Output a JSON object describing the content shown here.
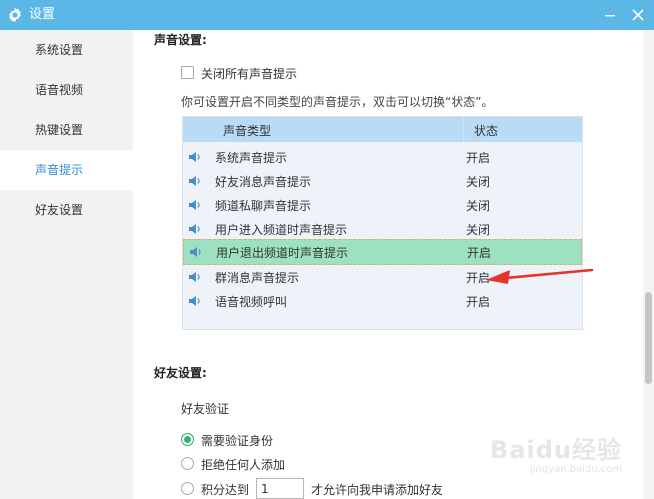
{
  "window": {
    "title": "设置"
  },
  "sidebar": {
    "items": [
      {
        "label": "系统设置"
      },
      {
        "label": "语音视频"
      },
      {
        "label": "热键设置"
      },
      {
        "label": "声音提示",
        "active": true
      },
      {
        "label": "好友设置"
      }
    ]
  },
  "sound_settings": {
    "section_title": "声音设置:",
    "mute_all_label": "关闭所有声音提示",
    "hint": "你可设置开启不同类型的声音提示，双击可以切换“状态”。",
    "table": {
      "col_type": "声音类型",
      "col_status": "状态",
      "rows": [
        {
          "name": "系统声音提示",
          "status": "开启"
        },
        {
          "name": "好友消息声音提示",
          "status": "关闭"
        },
        {
          "name": "频道私聊声音提示",
          "status": "关闭"
        },
        {
          "name": "用户进入频道时声音提示",
          "status": "关闭"
        },
        {
          "name": "用户退出频道时声音提示",
          "status": "开启",
          "selected": true
        },
        {
          "name": "群消息声音提示",
          "status": "开启"
        },
        {
          "name": "语音视频呼叫",
          "status": "开启"
        }
      ]
    }
  },
  "friend_settings": {
    "section_title": "好友设置:",
    "verify_title": "好友验证",
    "options": [
      {
        "label": "需要验证身份",
        "checked": true
      },
      {
        "label": "拒绝任何人添加",
        "checked": false
      },
      {
        "label": "积分达到",
        "checked": false
      }
    ],
    "points_value": "1",
    "points_suffix": "才允许向我申请添加好友"
  },
  "watermark": {
    "text": "Baidu经验",
    "sub": "jingyan.baidu.com"
  },
  "colors": {
    "titlebar": "#5bb8e6",
    "accent": "#2e8ed8",
    "selected_row": "#9de2c0",
    "arrow": "#e8322b"
  },
  "icons": {
    "title": "gear-icon",
    "row": "speaker-icon"
  }
}
